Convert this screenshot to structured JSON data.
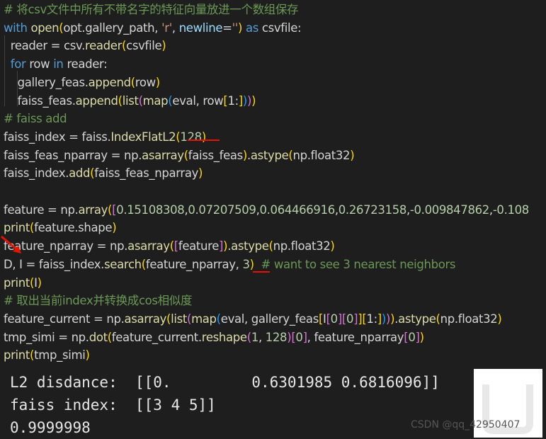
{
  "code_lines": [
    [
      [
        "# 将csv文件中所有不带名字的特征向量放进一个数组保存",
        "comment"
      ]
    ],
    [
      [
        "with",
        "keyword"
      ],
      [
        " ",
        "plain"
      ],
      [
        "open",
        "func"
      ],
      [
        "(",
        "bracket1"
      ],
      [
        "opt.gallery_path, ",
        "plain"
      ],
      [
        "'r'",
        "string"
      ],
      [
        ", ",
        "plain"
      ],
      [
        "newline",
        "param"
      ],
      [
        "=",
        "plain"
      ],
      [
        "''",
        "string"
      ],
      [
        ")",
        "bracket1"
      ],
      [
        " as ",
        "keyword"
      ],
      [
        "csvfile:",
        "plain"
      ]
    ],
    [
      [
        "  reader = csv.",
        "plain"
      ],
      [
        "reader",
        "func"
      ],
      [
        "(",
        "bracket1"
      ],
      [
        "csvfile",
        "plain"
      ],
      [
        ")",
        "bracket1"
      ]
    ],
    [
      [
        "  ",
        "plain"
      ],
      [
        "for",
        "keyword"
      ],
      [
        " row ",
        "plain"
      ],
      [
        "in",
        "keyword"
      ],
      [
        " reader:",
        "plain"
      ]
    ],
    [
      [
        "    gallery_feas.",
        "plain"
      ],
      [
        "append",
        "func"
      ],
      [
        "(",
        "bracket1"
      ],
      [
        "row",
        "plain"
      ],
      [
        ")",
        "bracket1"
      ]
    ],
    [
      [
        "    faiss_feas.",
        "plain"
      ],
      [
        "append",
        "func"
      ],
      [
        "(",
        "bracket1"
      ],
      [
        "list",
        "func"
      ],
      [
        "(",
        "bracket2"
      ],
      [
        "map",
        "func"
      ],
      [
        "(",
        "bracket3"
      ],
      [
        "eval, row",
        "plain"
      ],
      [
        "[",
        "bracket1"
      ],
      [
        "1:",
        "plain"
      ],
      [
        "]",
        "bracket1"
      ],
      [
        ")",
        "bracket3"
      ],
      [
        ")",
        "bracket2"
      ],
      [
        ")",
        "bracket1"
      ]
    ],
    [
      [
        "# faiss add",
        "comment"
      ]
    ],
    [
      [
        "faiss_index = faiss.",
        "plain"
      ],
      [
        "IndexFlatL2",
        "func"
      ],
      [
        "(",
        "bracket1"
      ],
      [
        "128",
        "number"
      ],
      [
        ")",
        "bracket1"
      ]
    ],
    [
      [
        "faiss_feas_nparray = np.",
        "plain"
      ],
      [
        "asarray",
        "func"
      ],
      [
        "(",
        "bracket1"
      ],
      [
        "faiss_feas",
        "plain"
      ],
      [
        ")",
        "bracket1"
      ],
      [
        ".",
        "plain"
      ],
      [
        "astype",
        "func"
      ],
      [
        "(",
        "bracket1"
      ],
      [
        "np.float32",
        "plain"
      ],
      [
        ")",
        "bracket1"
      ]
    ],
    [
      [
        "faiss_index.",
        "plain"
      ],
      [
        "add",
        "func"
      ],
      [
        "(",
        "bracket1"
      ],
      [
        "faiss_feas_nparray",
        "plain"
      ],
      [
        ")",
        "bracket1"
      ]
    ],
    [
      [
        "",
        "plain"
      ]
    ],
    [
      [
        "feature = np.",
        "plain"
      ],
      [
        "array",
        "func"
      ],
      [
        "(",
        "bracket1"
      ],
      [
        "[",
        "bracket2"
      ],
      [
        "0.15108308",
        "number"
      ],
      [
        ",",
        "plain"
      ],
      [
        "0.07207509",
        "number"
      ],
      [
        ",",
        "plain"
      ],
      [
        "0.064466916",
        "number"
      ],
      [
        ",",
        "plain"
      ],
      [
        "0.26723158",
        "number"
      ],
      [
        ",",
        "plain"
      ],
      [
        "-0.009847862",
        "number"
      ],
      [
        ",",
        "plain"
      ],
      [
        "-0.108",
        "number"
      ]
    ],
    [
      [
        "print",
        "func"
      ],
      [
        "(",
        "bracket1"
      ],
      [
        "feature.shape",
        "plain"
      ],
      [
        ")",
        "bracket1"
      ]
    ],
    [
      [
        "feature_nparray = np.",
        "plain"
      ],
      [
        "asarray",
        "func"
      ],
      [
        "(",
        "bracket1"
      ],
      [
        "[",
        "bracket2"
      ],
      [
        "feature",
        "plain"
      ],
      [
        "]",
        "bracket2"
      ],
      [
        ")",
        "bracket1"
      ],
      [
        ".",
        "plain"
      ],
      [
        "astype",
        "func"
      ],
      [
        "(",
        "bracket1"
      ],
      [
        "np.float32",
        "plain"
      ],
      [
        ")",
        "bracket1"
      ]
    ],
    [
      [
        "D, I = faiss_index.",
        "plain"
      ],
      [
        "search",
        "func"
      ],
      [
        "(",
        "bracket1"
      ],
      [
        "feature_nparray, ",
        "plain"
      ],
      [
        "3",
        "number"
      ],
      [
        ")",
        "bracket1"
      ],
      [
        "  # want to see 3 nearest neighbors",
        "comment"
      ]
    ],
    [
      [
        "print",
        "func"
      ],
      [
        "(",
        "bracket1"
      ],
      [
        "I",
        "plain"
      ],
      [
        ")",
        "bracket1"
      ]
    ],
    [
      [
        "# 取出当前index并转换成cos相似度",
        "comment"
      ]
    ],
    [
      [
        "feature_current = np.",
        "plain"
      ],
      [
        "asarray",
        "func"
      ],
      [
        "(",
        "bracket1"
      ],
      [
        "list",
        "func"
      ],
      [
        "(",
        "bracket2"
      ],
      [
        "map",
        "func"
      ],
      [
        "(",
        "bracket3"
      ],
      [
        "eval, gallery_feas",
        "plain"
      ],
      [
        "[",
        "bracket1"
      ],
      [
        "I",
        "plain"
      ],
      [
        "[",
        "bracket2"
      ],
      [
        "0",
        "number"
      ],
      [
        "]",
        "bracket2"
      ],
      [
        "[",
        "bracket2"
      ],
      [
        "0",
        "number"
      ],
      [
        "]",
        "bracket2"
      ],
      [
        "]",
        "bracket1"
      ],
      [
        "[",
        "bracket1"
      ],
      [
        "1:",
        "plain"
      ],
      [
        "]",
        "bracket1"
      ],
      [
        ")",
        "bracket3"
      ],
      [
        ")",
        "bracket2"
      ],
      [
        ")",
        "bracket1"
      ],
      [
        ".",
        "plain"
      ],
      [
        "astype",
        "func"
      ],
      [
        "(",
        "bracket1"
      ],
      [
        "np.float32",
        "plain"
      ],
      [
        ")",
        "bracket1"
      ]
    ],
    [
      [
        "tmp_simi = np.",
        "plain"
      ],
      [
        "dot",
        "func"
      ],
      [
        "(",
        "bracket1"
      ],
      [
        "feature_current.",
        "plain"
      ],
      [
        "reshape",
        "func"
      ],
      [
        "(",
        "bracket2"
      ],
      [
        "1",
        "number"
      ],
      [
        ", ",
        "plain"
      ],
      [
        "128",
        "number"
      ],
      [
        ")",
        "bracket2"
      ],
      [
        "[",
        "bracket2"
      ],
      [
        "0",
        "number"
      ],
      [
        "]",
        "bracket2"
      ],
      [
        ", feature_nparray",
        "plain"
      ],
      [
        "[",
        "bracket2"
      ],
      [
        "0",
        "number"
      ],
      [
        "]",
        "bracket2"
      ],
      [
        ")",
        "bracket1"
      ]
    ],
    [
      [
        "print",
        "func"
      ],
      [
        "(",
        "bracket1"
      ],
      [
        "tmp_simi",
        "plain"
      ],
      [
        ")",
        "bracket1"
      ]
    ]
  ],
  "token_colors": {
    "comment": "#6a9955",
    "keyword": "#569cd6",
    "func": "#dcdcaa",
    "string": "#ce9178",
    "number": "#b5cea8",
    "param": "#9cdcfe",
    "plain": "#d4d4d4",
    "bracket1": "#ffd700",
    "bracket2": "#da70d6",
    "bracket3": "#179fff"
  },
  "terminal": {
    "line1": "L2 disdance:  [[0.         0.6301985 0.6816096]]",
    "line2": "faiss index:  [[3 4 5]]",
    "line3": "0.9999998"
  },
  "watermark": "CSDN @qq_42950407",
  "annotation_color": "#e51400"
}
